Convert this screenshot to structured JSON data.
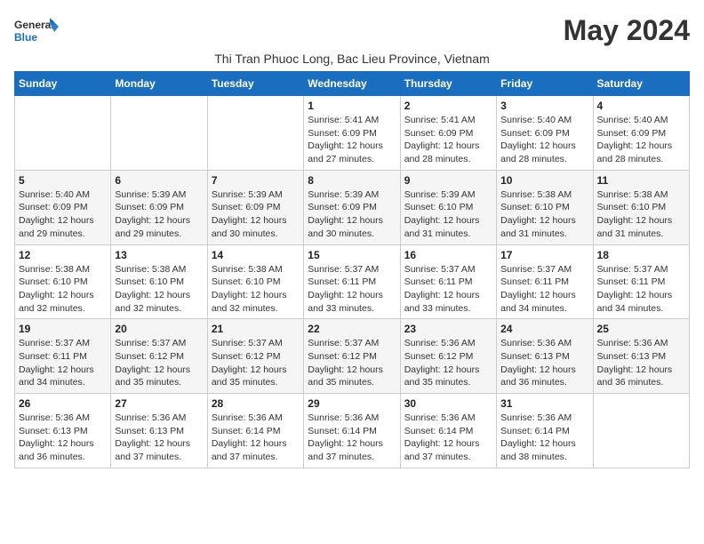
{
  "logo": {
    "line1": "General",
    "line2": "Blue"
  },
  "title": "May 2024",
  "subtitle": "Thi Tran Phuoc Long, Bac Lieu Province, Vietnam",
  "days_of_week": [
    "Sunday",
    "Monday",
    "Tuesday",
    "Wednesday",
    "Thursday",
    "Friday",
    "Saturday"
  ],
  "weeks": [
    [
      {
        "day": "",
        "info": ""
      },
      {
        "day": "",
        "info": ""
      },
      {
        "day": "",
        "info": ""
      },
      {
        "day": "1",
        "info": "Sunrise: 5:41 AM\nSunset: 6:09 PM\nDaylight: 12 hours and 27 minutes."
      },
      {
        "day": "2",
        "info": "Sunrise: 5:41 AM\nSunset: 6:09 PM\nDaylight: 12 hours and 28 minutes."
      },
      {
        "day": "3",
        "info": "Sunrise: 5:40 AM\nSunset: 6:09 PM\nDaylight: 12 hours and 28 minutes."
      },
      {
        "day": "4",
        "info": "Sunrise: 5:40 AM\nSunset: 6:09 PM\nDaylight: 12 hours and 28 minutes."
      }
    ],
    [
      {
        "day": "5",
        "info": "Sunrise: 5:40 AM\nSunset: 6:09 PM\nDaylight: 12 hours and 29 minutes."
      },
      {
        "day": "6",
        "info": "Sunrise: 5:39 AM\nSunset: 6:09 PM\nDaylight: 12 hours and 29 minutes."
      },
      {
        "day": "7",
        "info": "Sunrise: 5:39 AM\nSunset: 6:09 PM\nDaylight: 12 hours and 30 minutes."
      },
      {
        "day": "8",
        "info": "Sunrise: 5:39 AM\nSunset: 6:09 PM\nDaylight: 12 hours and 30 minutes."
      },
      {
        "day": "9",
        "info": "Sunrise: 5:39 AM\nSunset: 6:10 PM\nDaylight: 12 hours and 31 minutes."
      },
      {
        "day": "10",
        "info": "Sunrise: 5:38 AM\nSunset: 6:10 PM\nDaylight: 12 hours and 31 minutes."
      },
      {
        "day": "11",
        "info": "Sunrise: 5:38 AM\nSunset: 6:10 PM\nDaylight: 12 hours and 31 minutes."
      }
    ],
    [
      {
        "day": "12",
        "info": "Sunrise: 5:38 AM\nSunset: 6:10 PM\nDaylight: 12 hours and 32 minutes."
      },
      {
        "day": "13",
        "info": "Sunrise: 5:38 AM\nSunset: 6:10 PM\nDaylight: 12 hours and 32 minutes."
      },
      {
        "day": "14",
        "info": "Sunrise: 5:38 AM\nSunset: 6:10 PM\nDaylight: 12 hours and 32 minutes."
      },
      {
        "day": "15",
        "info": "Sunrise: 5:37 AM\nSunset: 6:11 PM\nDaylight: 12 hours and 33 minutes."
      },
      {
        "day": "16",
        "info": "Sunrise: 5:37 AM\nSunset: 6:11 PM\nDaylight: 12 hours and 33 minutes."
      },
      {
        "day": "17",
        "info": "Sunrise: 5:37 AM\nSunset: 6:11 PM\nDaylight: 12 hours and 34 minutes."
      },
      {
        "day": "18",
        "info": "Sunrise: 5:37 AM\nSunset: 6:11 PM\nDaylight: 12 hours and 34 minutes."
      }
    ],
    [
      {
        "day": "19",
        "info": "Sunrise: 5:37 AM\nSunset: 6:11 PM\nDaylight: 12 hours and 34 minutes."
      },
      {
        "day": "20",
        "info": "Sunrise: 5:37 AM\nSunset: 6:12 PM\nDaylight: 12 hours and 35 minutes."
      },
      {
        "day": "21",
        "info": "Sunrise: 5:37 AM\nSunset: 6:12 PM\nDaylight: 12 hours and 35 minutes."
      },
      {
        "day": "22",
        "info": "Sunrise: 5:37 AM\nSunset: 6:12 PM\nDaylight: 12 hours and 35 minutes."
      },
      {
        "day": "23",
        "info": "Sunrise: 5:36 AM\nSunset: 6:12 PM\nDaylight: 12 hours and 35 minutes."
      },
      {
        "day": "24",
        "info": "Sunrise: 5:36 AM\nSunset: 6:13 PM\nDaylight: 12 hours and 36 minutes."
      },
      {
        "day": "25",
        "info": "Sunrise: 5:36 AM\nSunset: 6:13 PM\nDaylight: 12 hours and 36 minutes."
      }
    ],
    [
      {
        "day": "26",
        "info": "Sunrise: 5:36 AM\nSunset: 6:13 PM\nDaylight: 12 hours and 36 minutes."
      },
      {
        "day": "27",
        "info": "Sunrise: 5:36 AM\nSunset: 6:13 PM\nDaylight: 12 hours and 37 minutes."
      },
      {
        "day": "28",
        "info": "Sunrise: 5:36 AM\nSunset: 6:14 PM\nDaylight: 12 hours and 37 minutes."
      },
      {
        "day": "29",
        "info": "Sunrise: 5:36 AM\nSunset: 6:14 PM\nDaylight: 12 hours and 37 minutes."
      },
      {
        "day": "30",
        "info": "Sunrise: 5:36 AM\nSunset: 6:14 PM\nDaylight: 12 hours and 37 minutes."
      },
      {
        "day": "31",
        "info": "Sunrise: 5:36 AM\nSunset: 6:14 PM\nDaylight: 12 hours and 38 minutes."
      },
      {
        "day": "",
        "info": ""
      }
    ]
  ]
}
